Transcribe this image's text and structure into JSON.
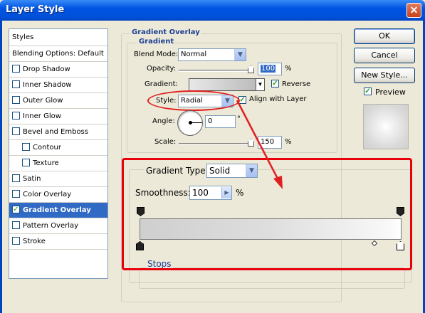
{
  "window": {
    "title": "Layer Style",
    "close_glyph": "✕"
  },
  "styles_list": {
    "header": "Styles",
    "blending": "Blending Options: Default",
    "items": [
      {
        "label": "Drop Shadow",
        "checked": false,
        "indent": false,
        "selected": false
      },
      {
        "label": "Inner Shadow",
        "checked": false,
        "indent": false,
        "selected": false
      },
      {
        "label": "Outer Glow",
        "checked": false,
        "indent": false,
        "selected": false
      },
      {
        "label": "Inner Glow",
        "checked": false,
        "indent": false,
        "selected": false
      },
      {
        "label": "Bevel and Emboss",
        "checked": false,
        "indent": false,
        "selected": false
      },
      {
        "label": "Contour",
        "checked": false,
        "indent": true,
        "selected": false
      },
      {
        "label": "Texture",
        "checked": false,
        "indent": true,
        "selected": false
      },
      {
        "label": "Satin",
        "checked": false,
        "indent": false,
        "selected": false
      },
      {
        "label": "Color Overlay",
        "checked": false,
        "indent": false,
        "selected": false
      },
      {
        "label": "Gradient Overlay",
        "checked": true,
        "indent": false,
        "selected": true
      },
      {
        "label": "Pattern Overlay",
        "checked": false,
        "indent": false,
        "selected": false
      },
      {
        "label": "Stroke",
        "checked": false,
        "indent": false,
        "selected": false
      }
    ]
  },
  "gradient_overlay": {
    "section_title": "Gradient Overlay",
    "group_title": "Gradient",
    "blend_mode_label": "Blend Mode:",
    "blend_mode_value": "Normal",
    "opacity_label": "Opacity:",
    "opacity_value": "100",
    "opacity_unit": "%",
    "opacity_level": 1.0,
    "gradient_label": "Gradient:",
    "reverse_label": "Reverse",
    "reverse_checked": true,
    "style_label": "Style:",
    "style_value": "Radial",
    "align_label": "Align with Layer",
    "align_checked": true,
    "angle_label": "Angle:",
    "angle_value": "0",
    "angle_unit": "°",
    "scale_label": "Scale:",
    "scale_value": "150",
    "scale_unit": "%",
    "scale_level": 1.0
  },
  "gradient_editor": {
    "type_label": "Gradient Type:",
    "type_value": "Solid",
    "smoothness_label": "Smoothness:",
    "smoothness_value": "100",
    "smoothness_unit": "%",
    "stops_label": "Stops"
  },
  "buttons": {
    "ok": "OK",
    "cancel": "Cancel",
    "new_style": "New Style...",
    "preview_label": "Preview",
    "preview_checked": true
  },
  "colors": {
    "accent_red": "#e8000b",
    "selection": "#316ac5",
    "title_blue": "#0054e3"
  }
}
